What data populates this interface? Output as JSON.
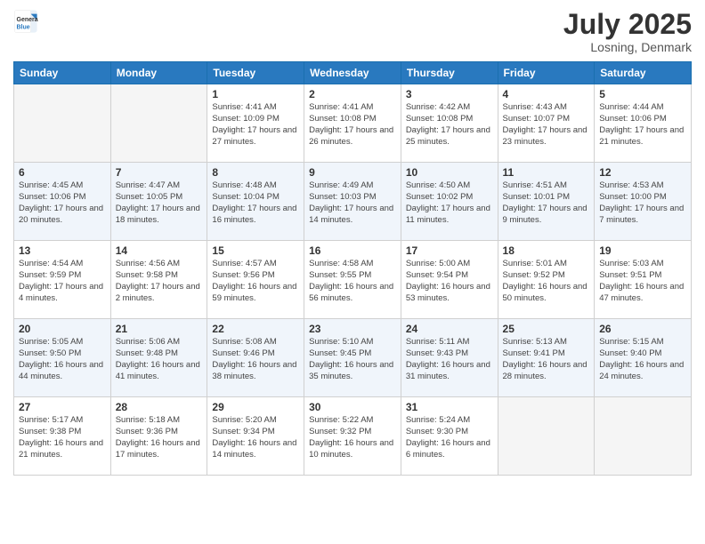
{
  "logo": {
    "line1": "General",
    "line2": "Blue"
  },
  "title": "July 2025",
  "subtitle": "Losning, Denmark",
  "headers": [
    "Sunday",
    "Monday",
    "Tuesday",
    "Wednesday",
    "Thursday",
    "Friday",
    "Saturday"
  ],
  "weeks": [
    [
      {
        "day": "",
        "info": ""
      },
      {
        "day": "",
        "info": ""
      },
      {
        "day": "1",
        "info": "Sunrise: 4:41 AM\nSunset: 10:09 PM\nDaylight: 17 hours and 27 minutes."
      },
      {
        "day": "2",
        "info": "Sunrise: 4:41 AM\nSunset: 10:08 PM\nDaylight: 17 hours and 26 minutes."
      },
      {
        "day": "3",
        "info": "Sunrise: 4:42 AM\nSunset: 10:08 PM\nDaylight: 17 hours and 25 minutes."
      },
      {
        "day": "4",
        "info": "Sunrise: 4:43 AM\nSunset: 10:07 PM\nDaylight: 17 hours and 23 minutes."
      },
      {
        "day": "5",
        "info": "Sunrise: 4:44 AM\nSunset: 10:06 PM\nDaylight: 17 hours and 21 minutes."
      }
    ],
    [
      {
        "day": "6",
        "info": "Sunrise: 4:45 AM\nSunset: 10:06 PM\nDaylight: 17 hours and 20 minutes."
      },
      {
        "day": "7",
        "info": "Sunrise: 4:47 AM\nSunset: 10:05 PM\nDaylight: 17 hours and 18 minutes."
      },
      {
        "day": "8",
        "info": "Sunrise: 4:48 AM\nSunset: 10:04 PM\nDaylight: 17 hours and 16 minutes."
      },
      {
        "day": "9",
        "info": "Sunrise: 4:49 AM\nSunset: 10:03 PM\nDaylight: 17 hours and 14 minutes."
      },
      {
        "day": "10",
        "info": "Sunrise: 4:50 AM\nSunset: 10:02 PM\nDaylight: 17 hours and 11 minutes."
      },
      {
        "day": "11",
        "info": "Sunrise: 4:51 AM\nSunset: 10:01 PM\nDaylight: 17 hours and 9 minutes."
      },
      {
        "day": "12",
        "info": "Sunrise: 4:53 AM\nSunset: 10:00 PM\nDaylight: 17 hours and 7 minutes."
      }
    ],
    [
      {
        "day": "13",
        "info": "Sunrise: 4:54 AM\nSunset: 9:59 PM\nDaylight: 17 hours and 4 minutes."
      },
      {
        "day": "14",
        "info": "Sunrise: 4:56 AM\nSunset: 9:58 PM\nDaylight: 17 hours and 2 minutes."
      },
      {
        "day": "15",
        "info": "Sunrise: 4:57 AM\nSunset: 9:56 PM\nDaylight: 16 hours and 59 minutes."
      },
      {
        "day": "16",
        "info": "Sunrise: 4:58 AM\nSunset: 9:55 PM\nDaylight: 16 hours and 56 minutes."
      },
      {
        "day": "17",
        "info": "Sunrise: 5:00 AM\nSunset: 9:54 PM\nDaylight: 16 hours and 53 minutes."
      },
      {
        "day": "18",
        "info": "Sunrise: 5:01 AM\nSunset: 9:52 PM\nDaylight: 16 hours and 50 minutes."
      },
      {
        "day": "19",
        "info": "Sunrise: 5:03 AM\nSunset: 9:51 PM\nDaylight: 16 hours and 47 minutes."
      }
    ],
    [
      {
        "day": "20",
        "info": "Sunrise: 5:05 AM\nSunset: 9:50 PM\nDaylight: 16 hours and 44 minutes."
      },
      {
        "day": "21",
        "info": "Sunrise: 5:06 AM\nSunset: 9:48 PM\nDaylight: 16 hours and 41 minutes."
      },
      {
        "day": "22",
        "info": "Sunrise: 5:08 AM\nSunset: 9:46 PM\nDaylight: 16 hours and 38 minutes."
      },
      {
        "day": "23",
        "info": "Sunrise: 5:10 AM\nSunset: 9:45 PM\nDaylight: 16 hours and 35 minutes."
      },
      {
        "day": "24",
        "info": "Sunrise: 5:11 AM\nSunset: 9:43 PM\nDaylight: 16 hours and 31 minutes."
      },
      {
        "day": "25",
        "info": "Sunrise: 5:13 AM\nSunset: 9:41 PM\nDaylight: 16 hours and 28 minutes."
      },
      {
        "day": "26",
        "info": "Sunrise: 5:15 AM\nSunset: 9:40 PM\nDaylight: 16 hours and 24 minutes."
      }
    ],
    [
      {
        "day": "27",
        "info": "Sunrise: 5:17 AM\nSunset: 9:38 PM\nDaylight: 16 hours and 21 minutes."
      },
      {
        "day": "28",
        "info": "Sunrise: 5:18 AM\nSunset: 9:36 PM\nDaylight: 16 hours and 17 minutes."
      },
      {
        "day": "29",
        "info": "Sunrise: 5:20 AM\nSunset: 9:34 PM\nDaylight: 16 hours and 14 minutes."
      },
      {
        "day": "30",
        "info": "Sunrise: 5:22 AM\nSunset: 9:32 PM\nDaylight: 16 hours and 10 minutes."
      },
      {
        "day": "31",
        "info": "Sunrise: 5:24 AM\nSunset: 9:30 PM\nDaylight: 16 hours and 6 minutes."
      },
      {
        "day": "",
        "info": ""
      },
      {
        "day": "",
        "info": ""
      }
    ]
  ]
}
